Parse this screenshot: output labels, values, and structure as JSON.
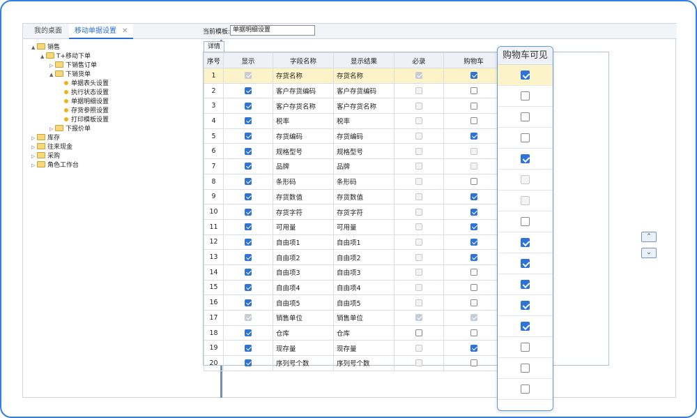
{
  "tabs": [
    {
      "label": "我的桌面"
    },
    {
      "label": "移动单据设置",
      "close": "✕"
    }
  ],
  "tree": [
    {
      "label": "销售",
      "level": 0,
      "icon": "folder",
      "arrow": "▲"
    },
    {
      "label": "T+移动下单",
      "level": 1,
      "icon": "folder",
      "arrow": "▲"
    },
    {
      "label": "下销售订单",
      "level": 2,
      "icon": "folder",
      "arrow": "▷"
    },
    {
      "label": "下销货单",
      "level": 2,
      "icon": "folder",
      "arrow": "▲"
    },
    {
      "label": "单据表头设置",
      "level": 3,
      "icon": "dot"
    },
    {
      "label": "执行状态设置",
      "level": 3,
      "icon": "dot"
    },
    {
      "label": "单据明细设置",
      "level": 3,
      "icon": "dot"
    },
    {
      "label": "存货参照设置",
      "level": 3,
      "icon": "dot"
    },
    {
      "label": "打印模板设置",
      "level": 3,
      "icon": "dot"
    },
    {
      "label": "下报价单",
      "level": 2,
      "icon": "folder",
      "arrow": "▷"
    },
    {
      "label": "库存",
      "level": 0,
      "icon": "folder",
      "arrow": "▷"
    },
    {
      "label": "往来现金",
      "level": 0,
      "icon": "folder",
      "arrow": "▷"
    },
    {
      "label": "采购",
      "level": 0,
      "icon": "folder",
      "arrow": "▷"
    },
    {
      "label": "角色工作台",
      "level": 0,
      "icon": "folder",
      "arrow": "▷"
    }
  ],
  "template": {
    "label": "当前模板:",
    "value": "单据明细设置"
  },
  "subtab": "详情",
  "grid": {
    "headers": [
      "序号",
      "显示",
      "字段名称",
      "显示结果",
      "必录",
      "购物车"
    ],
    "rows": [
      {
        "no": "1",
        "show": "on-dis",
        "field": "存货名称",
        "result": "存货名称",
        "req": "on-dis",
        "cart": "on"
      },
      {
        "no": "2",
        "show": "on",
        "field": "客户存货编码",
        "result": "客户存货编码",
        "req": "dis",
        "cart": "off"
      },
      {
        "no": "3",
        "show": "on",
        "field": "客户存货名称",
        "result": "客户存货名称",
        "req": "dis",
        "cart": "off"
      },
      {
        "no": "4",
        "show": "on",
        "field": "税率",
        "result": "税率",
        "req": "dis",
        "cart": "off"
      },
      {
        "no": "5",
        "show": "on",
        "field": "存货编码",
        "result": "存货编码",
        "req": "dis",
        "cart": "on"
      },
      {
        "no": "6",
        "show": "on",
        "field": "规格型号",
        "result": "规格型号",
        "req": "dis",
        "cart": "dis"
      },
      {
        "no": "7",
        "show": "on",
        "field": "品牌",
        "result": "品牌",
        "req": "dis",
        "cart": "dis"
      },
      {
        "no": "8",
        "show": "on",
        "field": "条形码",
        "result": "条形码",
        "req": "dis",
        "cart": "off"
      },
      {
        "no": "9",
        "show": "on",
        "field": "存货数值",
        "result": "存货数值",
        "req": "dis",
        "cart": "on"
      },
      {
        "no": "10",
        "show": "on",
        "field": "存货字符",
        "result": "存货字符",
        "req": "dis",
        "cart": "on"
      },
      {
        "no": "11",
        "show": "on",
        "field": "可用量",
        "result": "可用量",
        "req": "dis",
        "cart": "on"
      },
      {
        "no": "12",
        "show": "on",
        "field": "自由项1",
        "result": "自由项1",
        "req": "dis",
        "cart": "on"
      },
      {
        "no": "13",
        "show": "on",
        "field": "自由项2",
        "result": "自由项2",
        "req": "dis",
        "cart": "on"
      },
      {
        "no": "14",
        "show": "on",
        "field": "自由项3",
        "result": "自由项3",
        "req": "dis",
        "cart": "off"
      },
      {
        "no": "15",
        "show": "on",
        "field": "自由项4",
        "result": "自由项4",
        "req": "dis",
        "cart": "off"
      },
      {
        "no": "16",
        "show": "on",
        "field": "自由项5",
        "result": "自由项5",
        "req": "dis",
        "cart": "off"
      },
      {
        "no": "17",
        "show": "on-dis",
        "field": "销售单位",
        "result": "销售单位",
        "req": "on-dis",
        "cart": "on-dis"
      },
      {
        "no": "18",
        "show": "on",
        "field": "仓库",
        "result": "仓库",
        "req": "off",
        "cart": "off"
      },
      {
        "no": "19",
        "show": "on",
        "field": "现存量",
        "result": "现存量",
        "req": "dis",
        "cart": "on"
      },
      {
        "no": "20",
        "show": "on",
        "field": "序列号个数",
        "result": "序列号个数",
        "req": "dis",
        "cart": "off"
      }
    ]
  },
  "nav": {
    "up": "⌃",
    "down": "⌄"
  },
  "popup": {
    "title": "购物车可见",
    "values": [
      "on",
      "off",
      "off",
      "off",
      "on",
      "dis",
      "dis",
      "off",
      "on",
      "on",
      "on",
      "on",
      "on",
      "off",
      "off",
      "off"
    ]
  }
}
